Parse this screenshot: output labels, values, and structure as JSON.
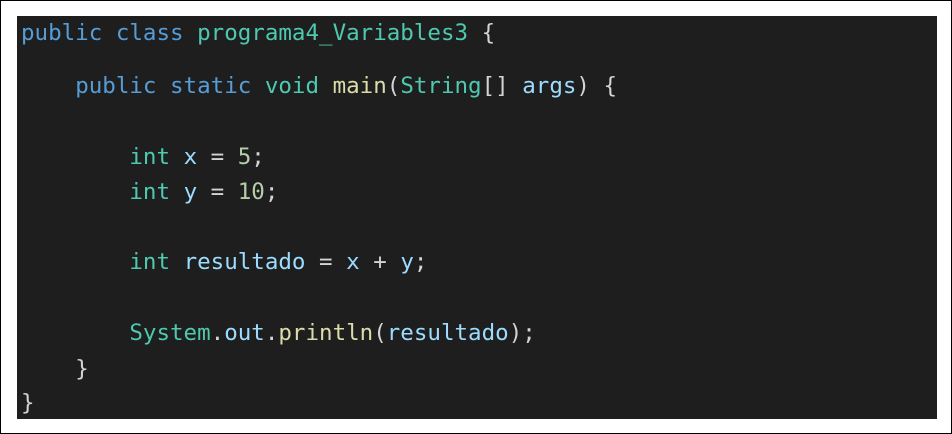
{
  "code": {
    "line1": {
      "kw_public": "public",
      "kw_class": "class",
      "class_name": "programa4_Variables3",
      "brace_open": "{"
    },
    "line2": {
      "kw_public": "public",
      "kw_static": "static",
      "kw_void": "void",
      "method": "main",
      "paren_open": "(",
      "type_string": "String",
      "brackets": "[]",
      "param": "args",
      "paren_close_brace": ") {"
    },
    "line3": {
      "kw_int": "int",
      "var": "x",
      "op": "=",
      "value": "5",
      "semi": ";"
    },
    "line4": {
      "kw_int": "int",
      "var": "y",
      "op": "=",
      "value": "10",
      "semi": ";"
    },
    "line5": {
      "kw_int": "int",
      "var": "resultado",
      "op": "=",
      "operand_a": "x",
      "plus": "+",
      "operand_b": "y",
      "semi": ";"
    },
    "line6": {
      "class_system": "System",
      "dot1": ".",
      "field_out": "out",
      "dot2": ".",
      "method_println": "println",
      "paren_open": "(",
      "arg": "resultado",
      "paren_close_semi": ");"
    },
    "line7": {
      "brace_close": "}"
    },
    "line8": {
      "brace_close": "}"
    }
  },
  "colors": {
    "background": "#1e1e1e",
    "keyword": "#569cd6",
    "type": "#4ec9b0",
    "function": "#dcdcaa",
    "variable": "#9cdcfe",
    "number": "#b5cea8",
    "punctuation": "#d4d4d4"
  }
}
